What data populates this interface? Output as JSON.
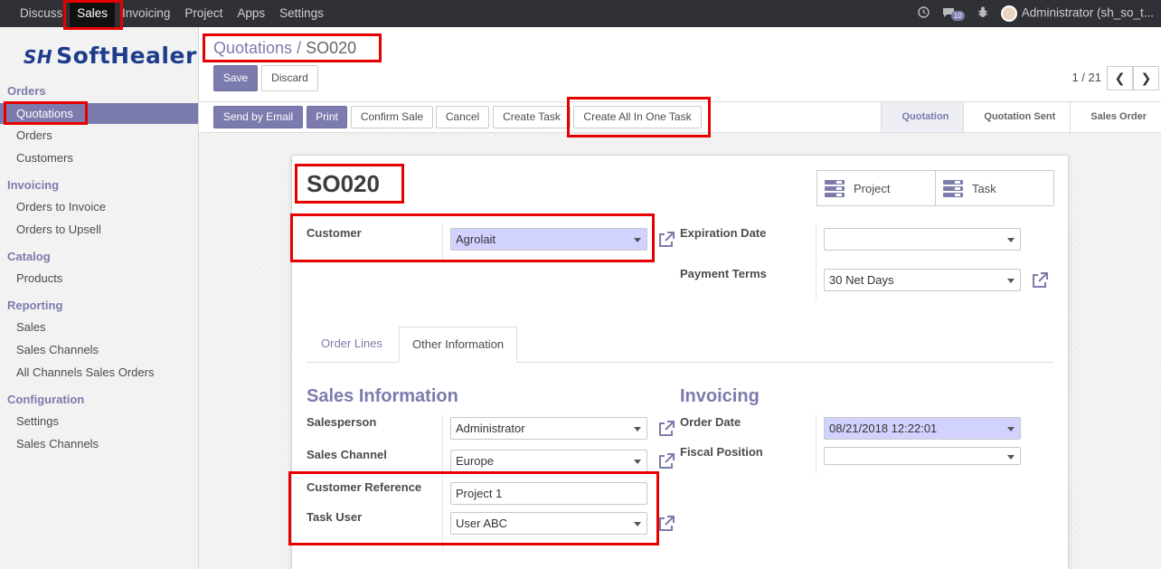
{
  "topbar": {
    "menu": [
      "Discuss",
      "Sales",
      "Invoicing",
      "Project",
      "Apps",
      "Settings"
    ],
    "active": "Sales",
    "message_count": "10",
    "user": "Administrator (sh_so_t..."
  },
  "sidebar": {
    "logo": "SoftHealer",
    "logo_mark": "SH",
    "groups": {
      "orders": "Orders",
      "invoicing": "Invoicing",
      "catalog": "Catalog",
      "reporting": "Reporting",
      "configuration": "Configuration"
    },
    "items": {
      "quotations": "Quotations",
      "orders": "Orders",
      "customers": "Customers",
      "orders_to_invoice": "Orders to Invoice",
      "orders_to_upsell": "Orders to Upsell",
      "products": "Products",
      "sales": "Sales",
      "sales_channels": "Sales Channels",
      "all_channels": "All Channels Sales Orders",
      "settings": "Settings",
      "config_sales_channels": "Sales Channels"
    }
  },
  "breadcrumb": {
    "parent": "Quotations",
    "sep": "/",
    "current": "SO020"
  },
  "buttons": {
    "save": "Save",
    "discard": "Discard",
    "send_email": "Send by Email",
    "print": "Print",
    "confirm": "Confirm Sale",
    "cancel": "Cancel",
    "create_task": "Create Task",
    "create_all": "Create All In One Task"
  },
  "pager": "1 / 21",
  "stages": [
    "Quotation",
    "Quotation Sent",
    "Sales Order"
  ],
  "form": {
    "title": "SO020",
    "smart_project": "Project",
    "smart_task": "Task",
    "customer_label": "Customer",
    "customer_value": "Agrolait",
    "expiration_label": "Expiration Date",
    "expiration_value": "",
    "payment_terms_label": "Payment Terms",
    "payment_terms_value": "30 Net Days",
    "tabs": [
      "Order Lines",
      "Other Information"
    ],
    "sales_info_title": "Sales Information",
    "invoicing_title": "Invoicing",
    "salesperson_label": "Salesperson",
    "salesperson_value": "Administrator",
    "sales_channel_label": "Sales Channel",
    "sales_channel_value": "Europe",
    "customer_ref_label": "Customer Reference",
    "customer_ref_value": "Project 1",
    "task_user_label": "Task User",
    "task_user_value": "User ABC",
    "order_date_label": "Order Date",
    "order_date_value": "08/21/2018 12:22:01",
    "fiscal_position_label": "Fiscal Position",
    "fiscal_position_value": ""
  },
  "colors": {
    "accent": "#7c7bad",
    "highlight": "#e60000",
    "topbar": "#2f3136"
  }
}
